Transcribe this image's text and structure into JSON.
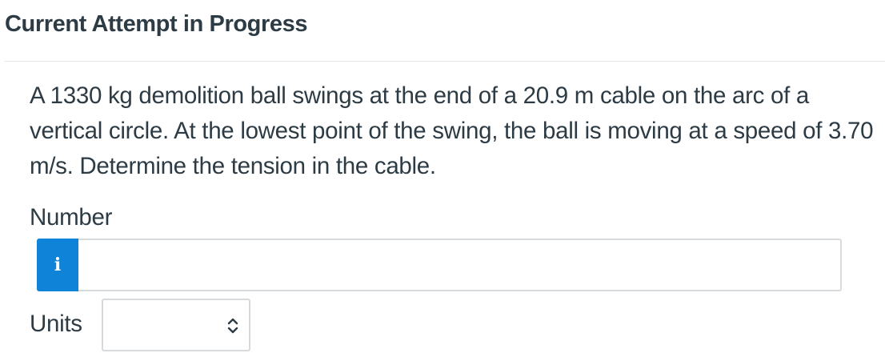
{
  "header": {
    "title": "Current Attempt in Progress"
  },
  "question": {
    "text": "A 1330 kg demolition ball swings at the end of a 20.9 m cable on the arc of a vertical circle. At the lowest point of the swing, the ball is moving at a speed of 3.70 m/s. Determine the tension in the cable."
  },
  "answer": {
    "number_label": "Number",
    "info_icon_glyph": "i",
    "number_value": "",
    "units_label": "Units",
    "units_selected": "",
    "icons": {
      "info": "info-icon",
      "units_dropdown": "chevron-up-down-icon"
    }
  },
  "colors": {
    "accent": "#0f83d8",
    "text": "#2d3b45",
    "border": "#d7dadc"
  }
}
